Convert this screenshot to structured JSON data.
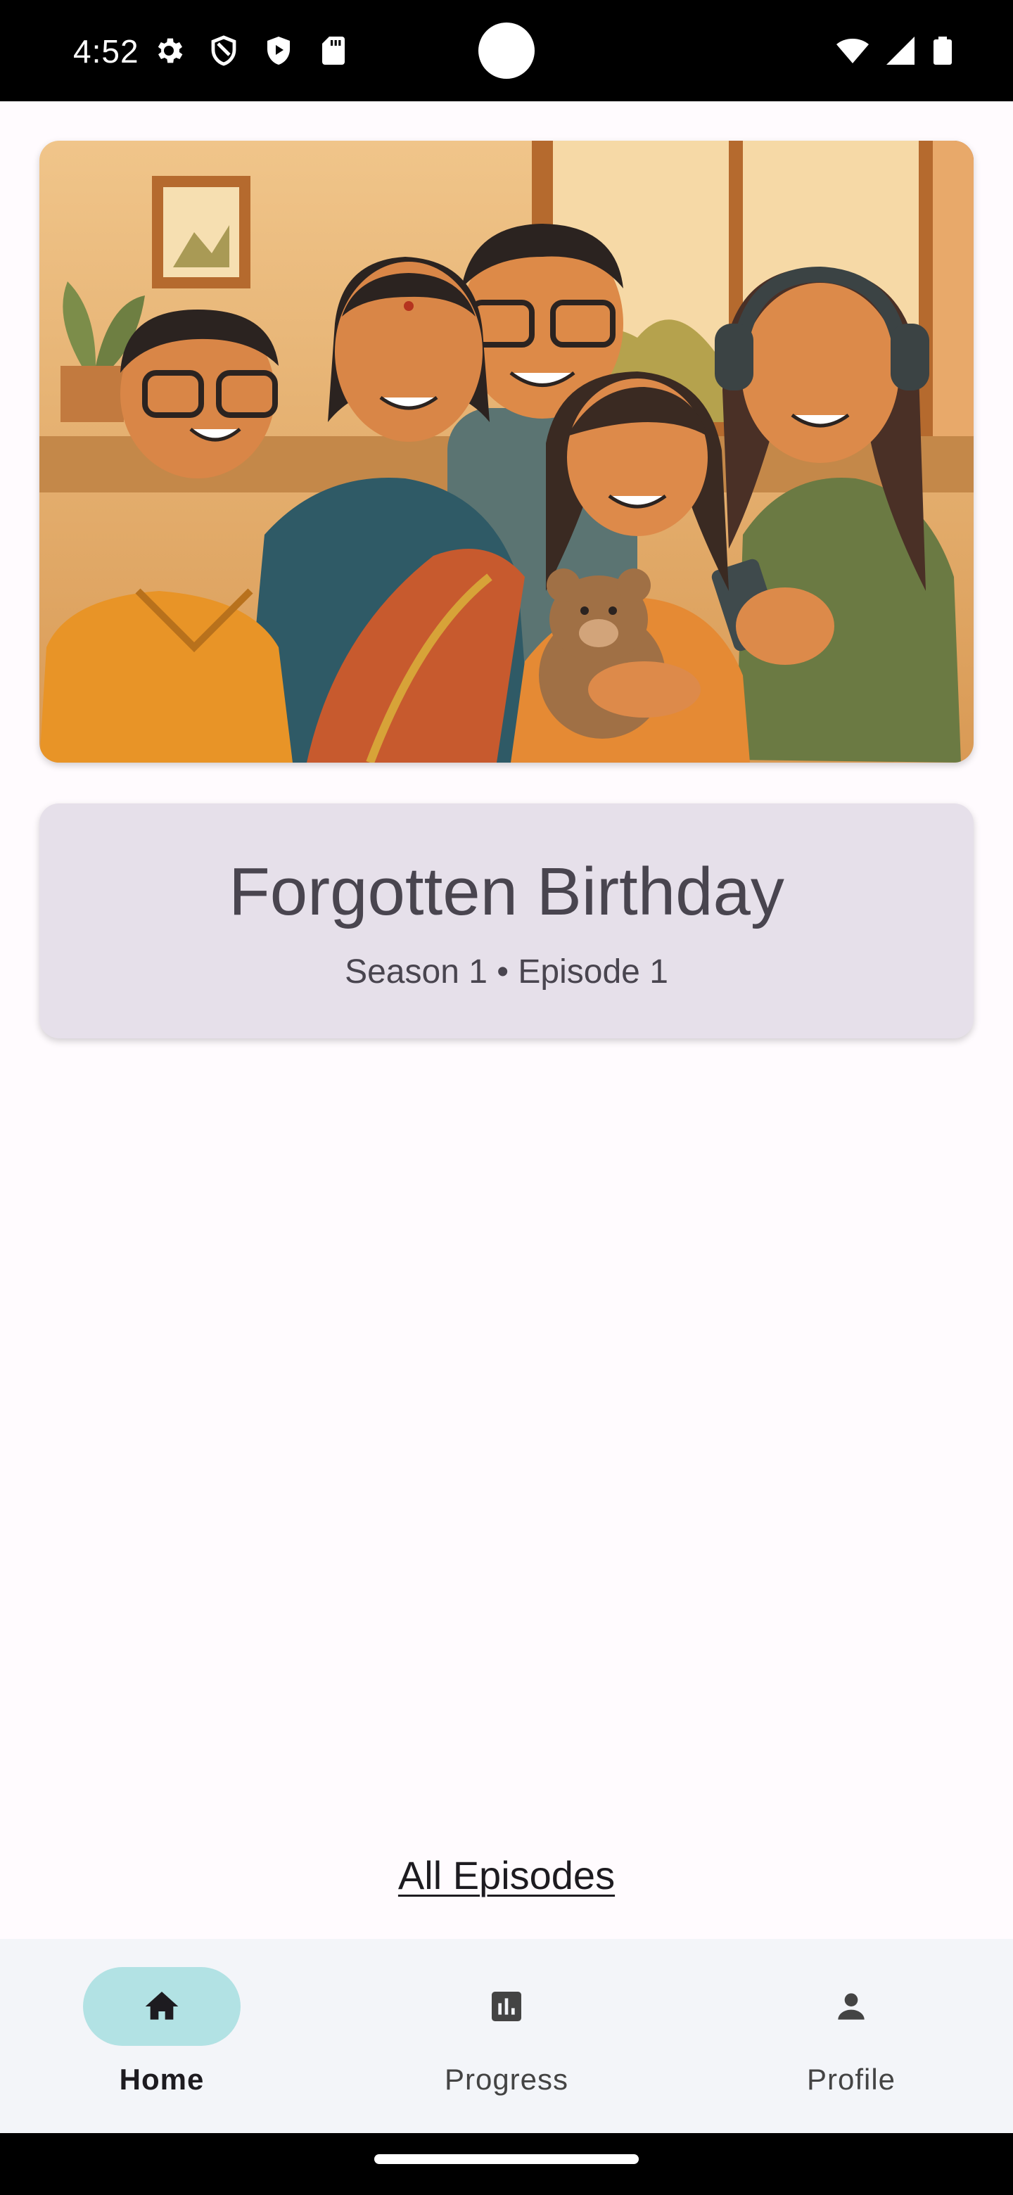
{
  "status_bar": {
    "time": "4:52",
    "icons": [
      "gear-icon",
      "shield-icon",
      "play-protect-icon",
      "sd-card-icon",
      "wifi-icon",
      "signal-icon",
      "battery-icon"
    ]
  },
  "hero": {
    "image": "family-illustration"
  },
  "episode": {
    "title": "Forgotten Birthday",
    "meta": "Season 1 • Episode 1"
  },
  "all_episodes_link": "All Episodes",
  "bottom_nav": {
    "items": [
      {
        "label": "Home",
        "icon": "home-icon",
        "active": true
      },
      {
        "label": "Progress",
        "icon": "bar-chart-icon",
        "active": false
      },
      {
        "label": "Profile",
        "icon": "person-icon",
        "active": false
      }
    ]
  },
  "colors": {
    "background": "#fffbfe",
    "card": "#e6e0ea",
    "nav_background": "#f3f5f9",
    "nav_active_pill": "#b2e2e4",
    "text_primary": "#1d1b20",
    "text_secondary": "#49454f"
  }
}
